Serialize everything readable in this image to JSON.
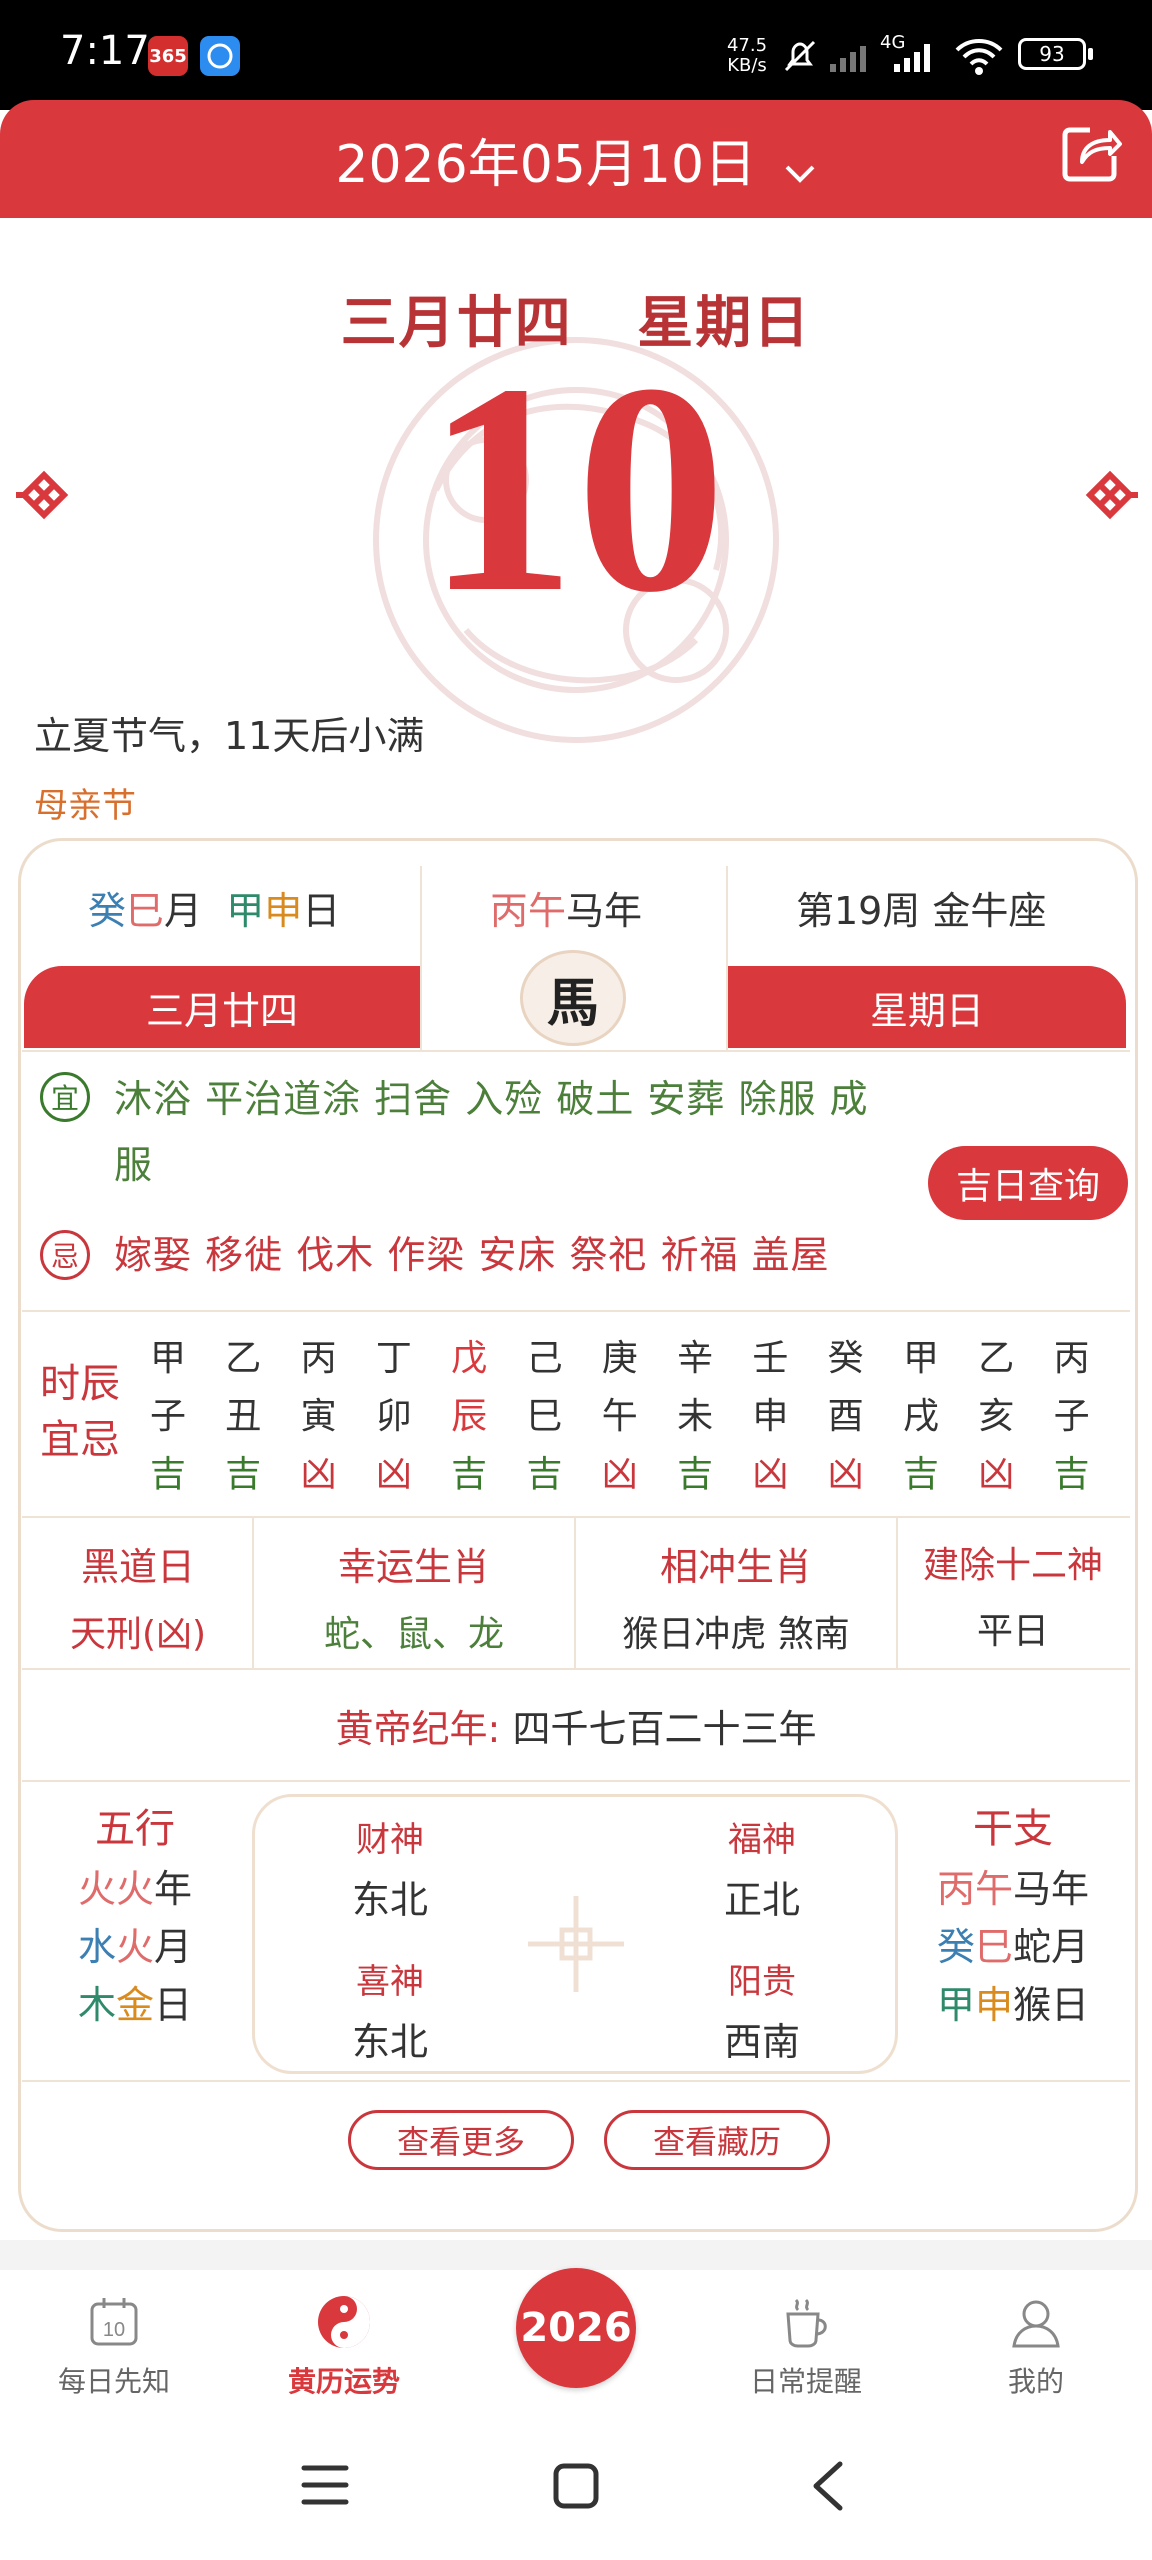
{
  "status_bar": {
    "time": "7:17",
    "app_icons": [
      "calendar-365-icon",
      "browser-icon"
    ],
    "net_speed": "47.5",
    "net_unit": "KB/s",
    "net_type": "4G",
    "battery": "93"
  },
  "header": {
    "date_label": "2026年05月10日",
    "dropdown_icon": "chevron-down-icon",
    "share_icon": "share-icon"
  },
  "hero": {
    "lunar_date": "三月廿四",
    "weekday": "星期日",
    "day_number": "10",
    "solar_term_text": "立夏节气，11天后小满",
    "festival": "母亲节"
  },
  "card": {
    "ganzhi_month_stem": "癸",
    "ganzhi_month_branch": "巳",
    "month_suffix": "月",
    "ganzhi_day_stem": "甲",
    "ganzhi_day_branch": "申",
    "day_suffix": "日",
    "year_stem": "丙",
    "year_branch": "午",
    "year_suffix": "马年",
    "week_info": "第19周 金牛座",
    "left_bar": "三月廿四",
    "right_bar": "星期日",
    "zodiac_badge": "馬",
    "yi_label": "宜",
    "yi_line1": "沐浴 平治道涂 扫舍 入殓 破土 安葬 除服 成",
    "yi_line2": "服",
    "lucky_day_button": "吉日查询",
    "ji_label": "忌",
    "ji_text": "嫁娶 移徙 伐木 作梁 安床 祭祀 祈福 盖屋",
    "shichen_label_1": "时辰",
    "shichen_label_2": "宜忌",
    "shichen": [
      {
        "stem": "甲",
        "branch": "子",
        "luck": "吉"
      },
      {
        "stem": "乙",
        "branch": "丑",
        "luck": "吉"
      },
      {
        "stem": "丙",
        "branch": "寅",
        "luck": "凶"
      },
      {
        "stem": "丁",
        "branch": "卯",
        "luck": "凶"
      },
      {
        "stem": "戊",
        "branch": "辰",
        "luck": "吉"
      },
      {
        "stem": "己",
        "branch": "巳",
        "luck": "吉"
      },
      {
        "stem": "庚",
        "branch": "午",
        "luck": "凶"
      },
      {
        "stem": "辛",
        "branch": "未",
        "luck": "吉"
      },
      {
        "stem": "壬",
        "branch": "申",
        "luck": "凶"
      },
      {
        "stem": "癸",
        "branch": "酉",
        "luck": "凶"
      },
      {
        "stem": "甲",
        "branch": "戌",
        "luck": "吉"
      },
      {
        "stem": "乙",
        "branch": "亥",
        "luck": "凶"
      },
      {
        "stem": "丙",
        "branch": "子",
        "luck": "吉"
      }
    ],
    "info_cells": [
      {
        "title": "黑道日",
        "value": "天刑(凶)"
      },
      {
        "title": "幸运生肖",
        "value": "蛇、鼠、龙"
      },
      {
        "title": "相冲生肖",
        "value": "猴日冲虎  煞南"
      },
      {
        "title": "建除十二神",
        "value": "平日"
      }
    ],
    "huangdi_label": "黄帝纪年:",
    "huangdi_value": "四千七百二十三年",
    "wuxing_title": "五行",
    "wuxing": [
      {
        "a": "火",
        "b": "火",
        "suffix": "年"
      },
      {
        "a": "水",
        "b": "火",
        "suffix": "月"
      },
      {
        "a": "木",
        "b": "金",
        "suffix": "日"
      }
    ],
    "gods": [
      {
        "title": "财神",
        "value": "东北"
      },
      {
        "title": "福神",
        "value": "正北"
      },
      {
        "title": "喜神",
        "value": "东北"
      },
      {
        "title": "阳贵",
        "value": "西南"
      }
    ],
    "ganzhi_title": "干支",
    "ganzhi_rows": [
      {
        "a": "丙",
        "b": "午",
        "suffix": "马年"
      },
      {
        "a": "癸",
        "b": "巳",
        "suffix": "蛇月"
      },
      {
        "a": "甲",
        "b": "申",
        "suffix": "猴日"
      }
    ],
    "more_button": "查看更多",
    "tibetan_button": "查看藏历"
  },
  "bottom_nav": {
    "items": [
      {
        "label": "每日先知",
        "icon": "calendar-icon"
      },
      {
        "label": "黄历运势",
        "icon": "yin-yang-icon"
      },
      {
        "label": "2026",
        "icon": "year-2026-icon"
      },
      {
        "label": "日常提醒",
        "icon": "cup-icon"
      },
      {
        "label": "我的",
        "icon": "profile-icon"
      }
    ],
    "active_index": 1
  },
  "colors": {
    "primary_red": "#d9383d",
    "good_green": "#3a7a2d",
    "bad_red": "#c9373d",
    "gold": "#d98b1e",
    "blue": "#3c7fb2"
  }
}
